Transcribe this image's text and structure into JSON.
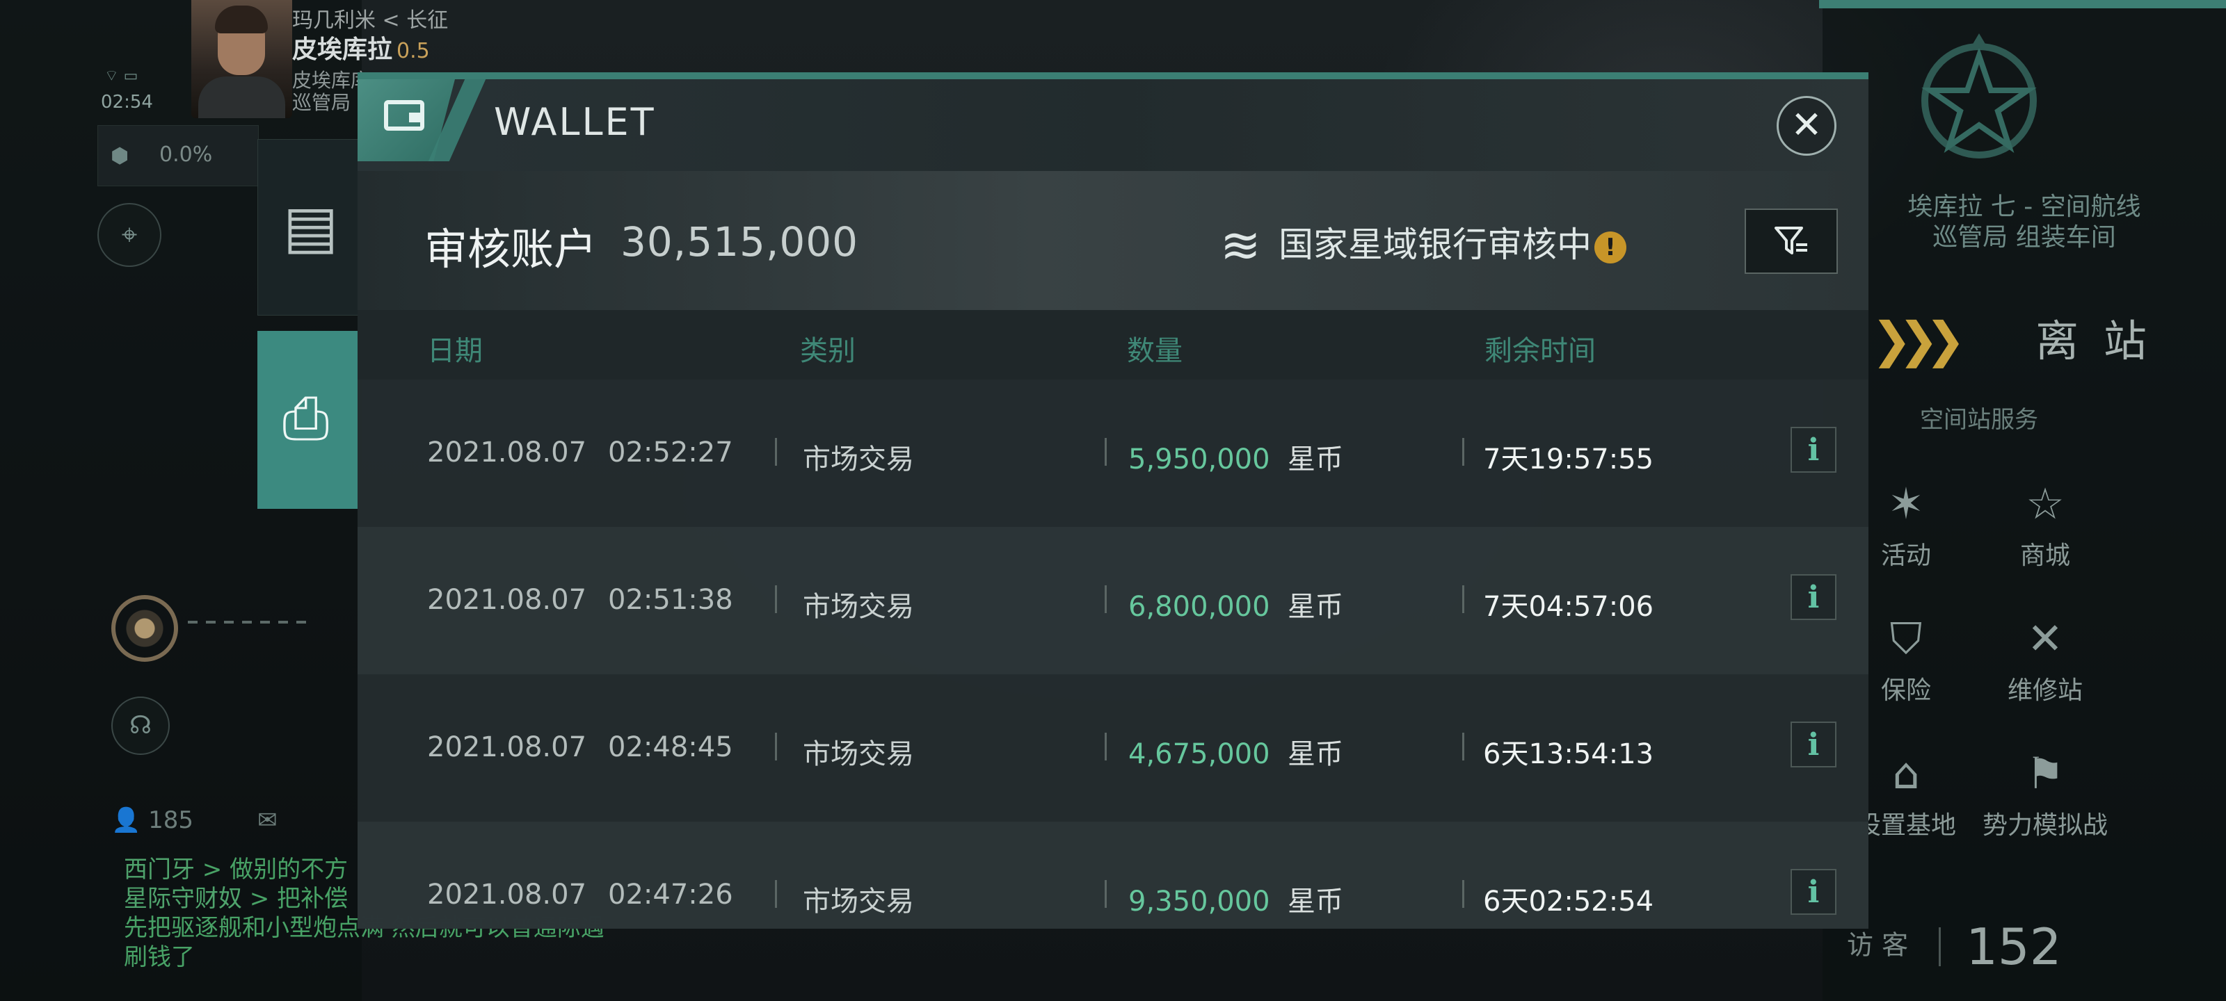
{
  "player": {
    "line1": "玛几利米 < 长征",
    "name": "皮埃库拉",
    "security": "0.5",
    "line3a": "皮埃库库",
    "line3b": "巡管局",
    "clock": "02:54"
  },
  "cargo": {
    "percent": "0.0%"
  },
  "social": {
    "count": "185"
  },
  "chat": {
    "lines": [
      {
        "name": "西门牙",
        "text": " > 做别的不方"
      },
      {
        "name": "星际守财奴",
        "text": " > 把补偿"
      },
      {
        "name": "",
        "text": "先把驱逐舰和小型炮点满 然后就可以普通际遇"
      },
      {
        "name": "",
        "text": "刷钱了"
      }
    ]
  },
  "station": {
    "name_line1": "埃库拉 七 - 空间航线",
    "name_line2": "巡管局 组装车间",
    "undock": "离 站",
    "services_title": "空间站服务",
    "services": [
      {
        "label": "活动",
        "icon": "party-popper-icon"
      },
      {
        "label": "商城",
        "icon": "store-icon"
      },
      {
        "label": "保险",
        "icon": "shield-icon"
      },
      {
        "label": "维修站",
        "icon": "wrench-icon"
      },
      {
        "label": "设置基地",
        "icon": "base-icon"
      },
      {
        "label": "势力模拟战",
        "icon": "crossed-flags-icon"
      }
    ],
    "visitors_label": "访 客",
    "visitors_count": "152"
  },
  "wallet": {
    "title": "WALLET",
    "account_label": "审核账户",
    "account_value": "30,515,000",
    "bank_status": "国家星域银行审核中",
    "columns": {
      "date": "日期",
      "type": "类别",
      "amount": "数量",
      "remaining": "剩余时间"
    },
    "rows": [
      {
        "date": "2021.08.07",
        "time": "02:52:27",
        "type": "市场交易",
        "amount": "5,950,000",
        "unit": "星币",
        "remaining": "7天19:57:55"
      },
      {
        "date": "2021.08.07",
        "time": "02:51:38",
        "type": "市场交易",
        "amount": "6,800,000",
        "unit": "星币",
        "remaining": "7天04:57:06"
      },
      {
        "date": "2021.08.07",
        "time": "02:48:45",
        "type": "市场交易",
        "amount": "4,675,000",
        "unit": "星币",
        "remaining": "6天13:54:13"
      },
      {
        "date": "2021.08.07",
        "time": "02:47:26",
        "type": "市场交易",
        "amount": "9,350,000",
        "unit": "星币",
        "remaining": "6天02:52:54"
      }
    ]
  },
  "colors": {
    "accent": "#3b7f74",
    "amount": "#66c79d",
    "column_header": "#3f8877",
    "warning": "#c79528",
    "undock_chevron": "#c9a23c"
  }
}
